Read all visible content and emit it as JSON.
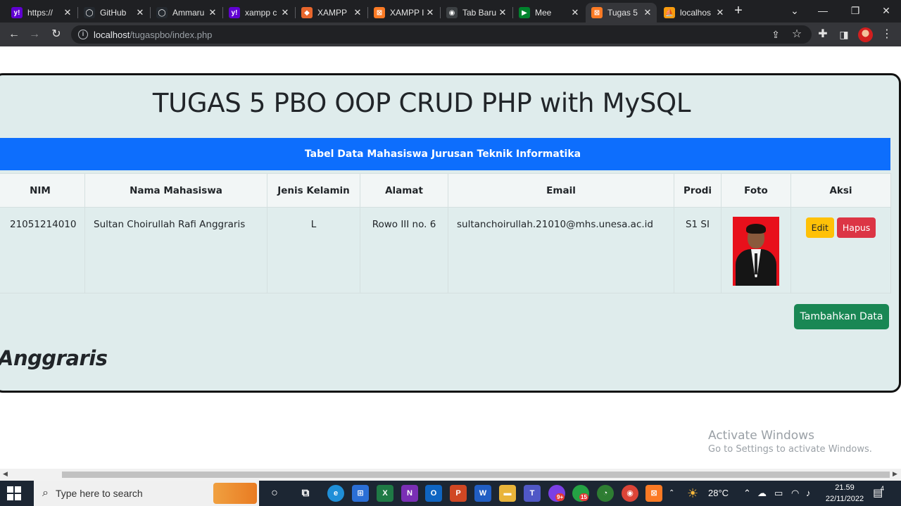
{
  "browser": {
    "tabs": [
      {
        "title": "https://",
        "favicon": "yahoo-icon",
        "color": "#6001d2",
        "glyph": "y!"
      },
      {
        "title": "GitHub",
        "favicon": "github-icon",
        "color": "#24292f",
        "glyph": "◯"
      },
      {
        "title": "Ammaru",
        "favicon": "github-icon",
        "color": "#24292f",
        "glyph": "◯"
      },
      {
        "title": "xampp c",
        "favicon": "yahoo-icon",
        "color": "#6001d2",
        "glyph": "y!"
      },
      {
        "title": "XAMPP",
        "favicon": "diamond-icon",
        "color": "#e8662c",
        "glyph": "◆"
      },
      {
        "title": "XAMPP I",
        "favicon": "xampp-icon",
        "color": "#fb7a24",
        "glyph": "⊠"
      },
      {
        "title": "Tab Baru",
        "favicon": "chrome-icon",
        "color": "#3c4043",
        "glyph": "◉"
      },
      {
        "title": "Mee",
        "favicon": "meet-icon",
        "color": "#00832d",
        "glyph": "▶"
      },
      {
        "title": "Tugas 5",
        "favicon": "xampp-icon",
        "color": "#fb7a24",
        "glyph": "⊠",
        "active": true
      },
      {
        "title": "localhos",
        "favicon": "phpmyadmin-icon",
        "color": "#f89c0e",
        "glyph": "⛵"
      }
    ],
    "url_host": "localhost",
    "url_path": "/tugaspbo/index.php"
  },
  "page": {
    "heading": "TUGAS 5 PBO OOP CRUD PHP with MySQL",
    "table_caption": "Tabel Data Mahasiswa Jurusan Teknik Informatika",
    "columns": [
      "NIM",
      "Nama Mahasiswa",
      "Jenis Kelamin",
      "Alamat",
      "Email",
      "Prodi",
      "Foto",
      "Aksi"
    ],
    "rows": [
      {
        "nim": "21051214010",
        "nama": "Sultan Choirullah Rafi Anggraris",
        "jenis_kelamin": "L",
        "alamat": "Rowo III no. 6",
        "email": "sultanchoirullah.21010@mhs.unesa.ac.id",
        "prodi": "S1 SI",
        "edit_label": "Edit",
        "delete_label": "Hapus"
      }
    ],
    "add_button": "Tambahkan Data",
    "author_fragment": "Anggraris"
  },
  "watermark": {
    "title": "Activate Windows",
    "subtitle": "Go to Settings to activate Windows."
  },
  "taskbar": {
    "search_placeholder": "Type here to search",
    "temperature": "28°C",
    "time": "21.59",
    "date": "22/11/2022",
    "teams_badge": "9+",
    "whatsapp_badge": "15",
    "notification_count": "4"
  },
  "colors": {
    "primary": "#0d6efd",
    "success": "#198754",
    "warning": "#ffc107",
    "danger": "#dc3545",
    "card_bg": "#dfecec"
  }
}
